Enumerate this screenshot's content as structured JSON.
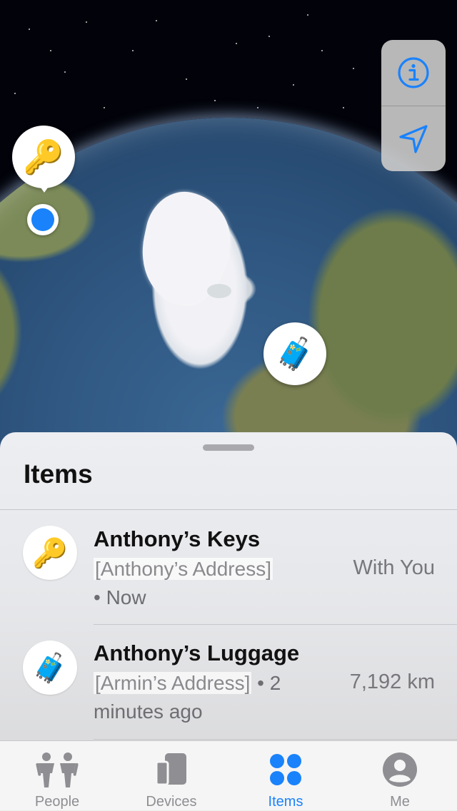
{
  "map": {
    "key_marker_icon": "key-emoji",
    "key_marker_glyph": "🔑",
    "luggage_marker_icon": "luggage-emoji",
    "luggage_marker_glyph": "🧳",
    "controls": [
      {
        "name": "info-icon"
      },
      {
        "name": "location-arrow-icon"
      }
    ],
    "accent_color": "#1a82fb"
  },
  "sheet": {
    "title": "Items",
    "items": [
      {
        "name": "Anthony’s Keys",
        "icon": "key-emoji",
        "glyph": "🔑",
        "address": "[Anthony’s Address]",
        "time": "• Now",
        "status": "With You"
      },
      {
        "name": "Anthony’s Luggage",
        "icon": "luggage-emoji",
        "glyph": "🧳",
        "address": "[Armin’s Address]",
        "time": "• 2 minutes ago",
        "status": "7,192 km"
      }
    ]
  },
  "tabbar": {
    "tabs": [
      {
        "label": "People",
        "icon": "people-icon",
        "active": false
      },
      {
        "label": "Devices",
        "icon": "devices-icon",
        "active": false
      },
      {
        "label": "Items",
        "icon": "items-icon",
        "active": true
      },
      {
        "label": "Me",
        "icon": "me-icon",
        "active": false
      }
    ]
  }
}
